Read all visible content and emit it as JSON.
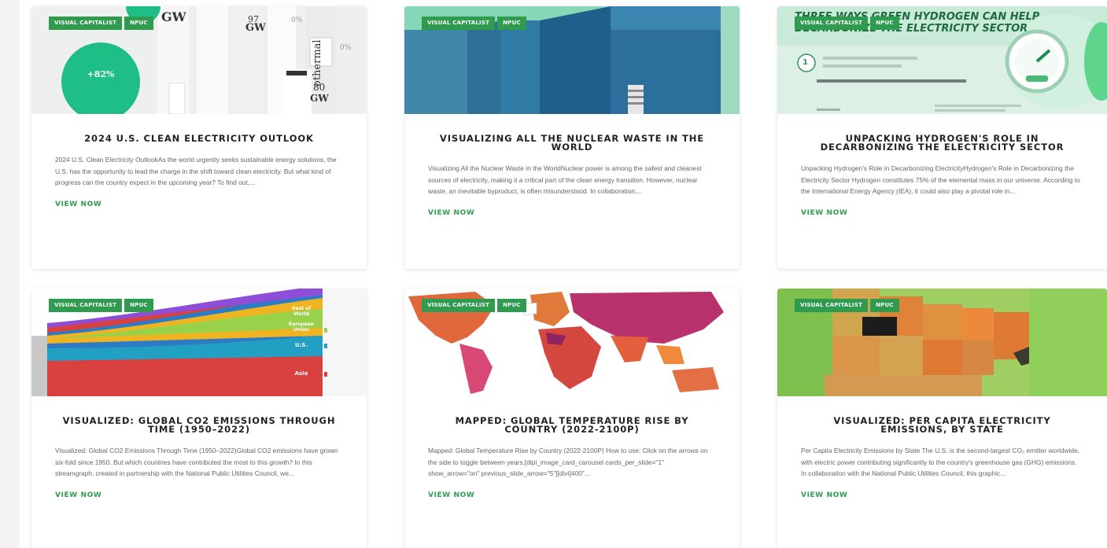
{
  "tags": [
    "VISUAL CAPITALIST",
    "NPUC"
  ],
  "view_label": "VIEW NOW",
  "accent_color": "#2f9b4f",
  "cards": [
    {
      "title": "2024 U.S. CLEAN ELECTRICITY OUTLOOK",
      "excerpt": "2024 U.S. Clean Electricity OutlookAs the world urgently seeks sustainable energy solutions, the U.S. has the opportunity to lead the charge in the shift toward clean electricity. But what kind of progress can the country expect in the upcoming year? To find out,...",
      "thumb_text": {
        "gw_top": "GW",
        "value_97": "97",
        "gw_97": "GW",
        "value_80": "80",
        "gw_80": "GW",
        "pct_0a": "0%",
        "pct_0b": "0%",
        "big_pct": "+82%",
        "word": "othermal"
      }
    },
    {
      "title": "VISUALIZING ALL THE NUCLEAR WASTE IN THE WORLD",
      "excerpt": "Visualizing All the Nuclear Waste in the WorldNuclear power is among the safest and cleanest sources of electricity, making it a critical part of the clean energy transition. However, nuclear waste, an inevitable byproduct, is often misunderstood. In collaboration,...",
      "thumb_text": {}
    },
    {
      "title": "UNPACKING HYDROGEN'S ROLE IN DECARBONIZING THE ELECTRICITY SECTOR",
      "excerpt": "Unpacking Hydrogen's Role in Decarbonizing ElectricityHydrogen's Role in Decarbonizing the Electricity Sector Hydrogen constitutes 75% of the elemental mass in our universe. According to the International Energy Agency (IEA), it could also play a pivotal role in...",
      "thumb_text": {
        "headline_1": "THREE WAYS GREEN HYDROGEN CAN HELP",
        "headline_2": "DECARBONIZE THE ELECTRICITY SECTOR",
        "step": "1"
      }
    },
    {
      "title": "VISUALIZED: GLOBAL CO2 EMISSIONS THROUGH TIME (1950–2022)",
      "excerpt": "Visualized: Global CO2 Emissions Through Time (1950–2022)Global CO2 emissions have grown six-fold since 1950. But which countries have contributed the most to this growth? In this streamgraph, created in partnership with the National Public Utilities Council, we...",
      "thumb_text": {
        "rest": "Rest of World",
        "europe": "European Union",
        "us": "U.S.",
        "asia": "Asia"
      }
    },
    {
      "title": "MAPPED: GLOBAL TEMPERATURE RISE BY COUNTRY (2022-2100P)",
      "excerpt": "Mapped: Global Temperature Rise by Country (2022-2100P) How to use: Click on the arrows on the side to toggle between years.[dipl_image_card_carousel cards_per_slide=\"1\" show_arrow=\"on\" previous_slide_arrow=\"5\"][divi]400\"...",
      "thumb_text": {}
    },
    {
      "title": "VISUALIZED: PER CAPITA ELECTRICITY EMISSIONS, BY STATE",
      "excerpt": "Per Capita Electricity Emissions by State The U.S. is the second-largest CO₂ emitter worldwide, with electric power contributing significantly to the country's greenhouse gas (GHG) emissions. In collaboration with the National Public Utilities Council, this graphic...",
      "thumb_text": {}
    }
  ]
}
